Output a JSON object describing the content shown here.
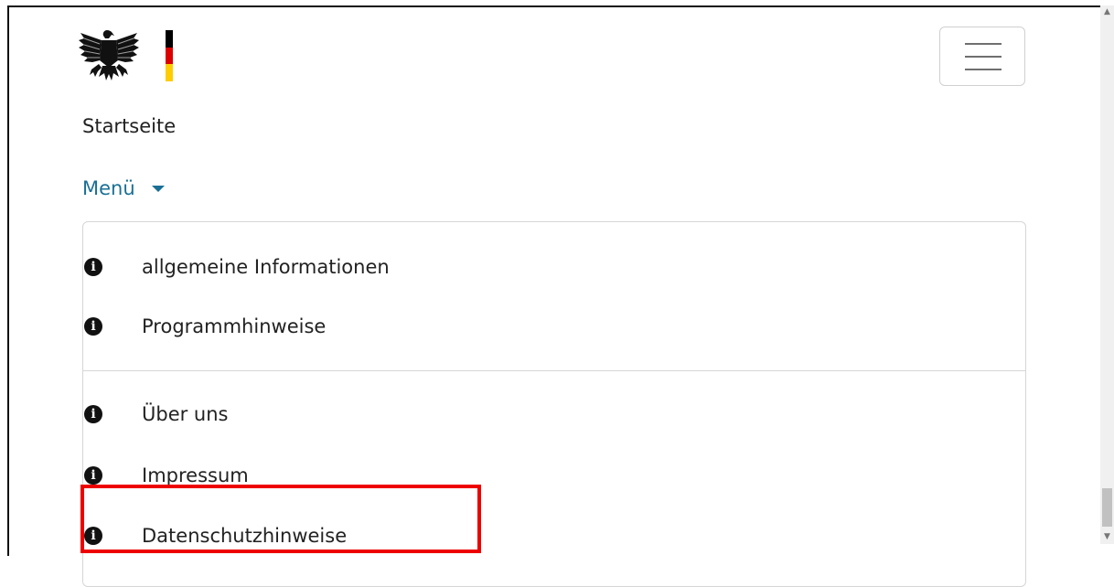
{
  "header": {
    "logo_icon": "federal-eagle-icon",
    "flag_colors": [
      "#000000",
      "#dd0000",
      "#ffcc00"
    ],
    "menu_toggle_icon": "hamburger-icon"
  },
  "breadcrumb": {
    "home_label": "Startseite"
  },
  "menu": {
    "toggle_label": "Menü",
    "toggle_icon": "caret-down-icon",
    "accent_color": "#1a6f95",
    "groups": [
      {
        "items": [
          {
            "icon": "info-icon",
            "label": "allgemeine Informationen"
          },
          {
            "icon": "info-icon",
            "label": "Programmhinweise"
          }
        ]
      },
      {
        "items": [
          {
            "icon": "info-icon",
            "label": "Über uns"
          },
          {
            "icon": "info-icon",
            "label": "Impressum"
          },
          {
            "icon": "info-icon",
            "label": "Datenschutzhinweise"
          }
        ]
      }
    ]
  },
  "highlight_color": "#ee0000"
}
